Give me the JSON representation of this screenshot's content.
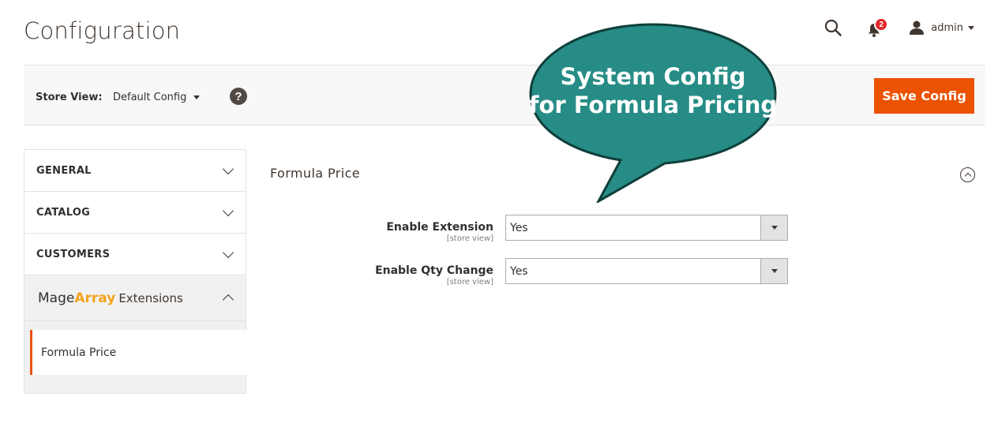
{
  "page": {
    "title": "Configuration"
  },
  "header": {
    "notifications_count": "2",
    "user_name": "admin"
  },
  "store_bar": {
    "store_view_label": "Store View:",
    "store_view_value": "Default Config",
    "help_symbol": "?",
    "save_label": "Save Config"
  },
  "callout": {
    "line1": "System Config",
    "line2": "for Formula Pricing",
    "color": "#268c85"
  },
  "sidebar": {
    "items": [
      {
        "label": "GENERAL"
      },
      {
        "label": "CATALOG"
      },
      {
        "label": "CUSTOMERS"
      }
    ],
    "extension_group": {
      "brand_prefix": "Mage",
      "brand_accent": "Array",
      "suffix": "Extensions"
    },
    "sub_item": "Formula Price"
  },
  "section": {
    "title": "Formula Price",
    "fields": [
      {
        "label": "Enable Extension",
        "scope": "[store view]",
        "value": "Yes"
      },
      {
        "label": "Enable Qty Change",
        "scope": "[store view]",
        "value": "Yes"
      }
    ]
  },
  "colors": {
    "accent": "#eb5202",
    "brand_accent": "#f7a21b",
    "badge": "#e22626"
  }
}
